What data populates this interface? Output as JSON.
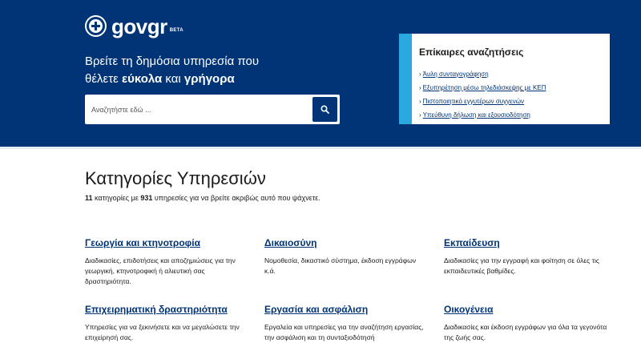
{
  "header": {
    "logo_text": "gov",
    "logo_text_gr": "gr",
    "logo_beta": "BETA",
    "hero_line1": "Βρείτε τη δημόσια υπηρεσία που",
    "hero_line2_prefix": "θέλετε ",
    "hero_line2_bold1": "εύκολα",
    "hero_line2_mid": " και ",
    "hero_line2_bold2": "γρήγορα",
    "search": {
      "placeholder": "Αναζητήστε εδώ ...",
      "value": ""
    }
  },
  "trending": {
    "title": "Επίκαιρες αναζητήσεις",
    "items": [
      "Άυλη συνταγογράφηση",
      "Εξυπηρέτηση μέσω τηλεδιάσκεψης με ΚΕΠ",
      "Πιστοποιητικό εγγυτέρων συγγενών",
      "Υπεύθυνη δήλωση και εξουσιοδότηση"
    ]
  },
  "main": {
    "title": "Κατηγορίες Υπηρεσιών",
    "count_categories": "11",
    "sub_mid": " κατηγορίες με ",
    "count_services": "931",
    "sub_end": " υπηρεσίες για να βρείτε ακριβώς αυτό που ψάχνετε.",
    "categories": [
      {
        "title": "Γεωργία και κτηνοτροφία",
        "desc": "Διαδικασίες, επιδοτήσεις και αποζημιώσεις για την γεωργική, κτηνοτροφική ή αλιευτική σας δραστηριότητα."
      },
      {
        "title": "Δικαιοσύνη",
        "desc": "Νομοθεσία, δικαστικό σύστημα, έκδοση εγγράφων κ.ά."
      },
      {
        "title": "Εκπαίδευση",
        "desc": "Διαδικασίες για την εγγραφή και φοίτηση σε όλες τις εκπαιδευτικές βαθμίδες."
      },
      {
        "title": "Επιχειρηματική δραστηριότητα",
        "desc": "Υπηρεσίες για να ξεκινήσετε και να μεγαλώσετε την επιχείρησή σας."
      },
      {
        "title": "Εργασία και ασφάλιση",
        "desc": "Εργαλεία και υπηρεσίες για την αναζήτηση εργασίας, την ασφάλιση και τη συνταξιοδότησή"
      },
      {
        "title": "Οικογένεια",
        "desc": "Διαδικασίες και έκδοση εγγράφων για όλα τα γεγονότα της ζωής σας."
      }
    ]
  },
  "colors": {
    "primary": "#003476",
    "accent": "#2aa9e0"
  },
  "icons": {
    "emblem": "greek-coat-of-arms-icon",
    "search": "search-icon",
    "chevron": "chevron-right-icon"
  }
}
